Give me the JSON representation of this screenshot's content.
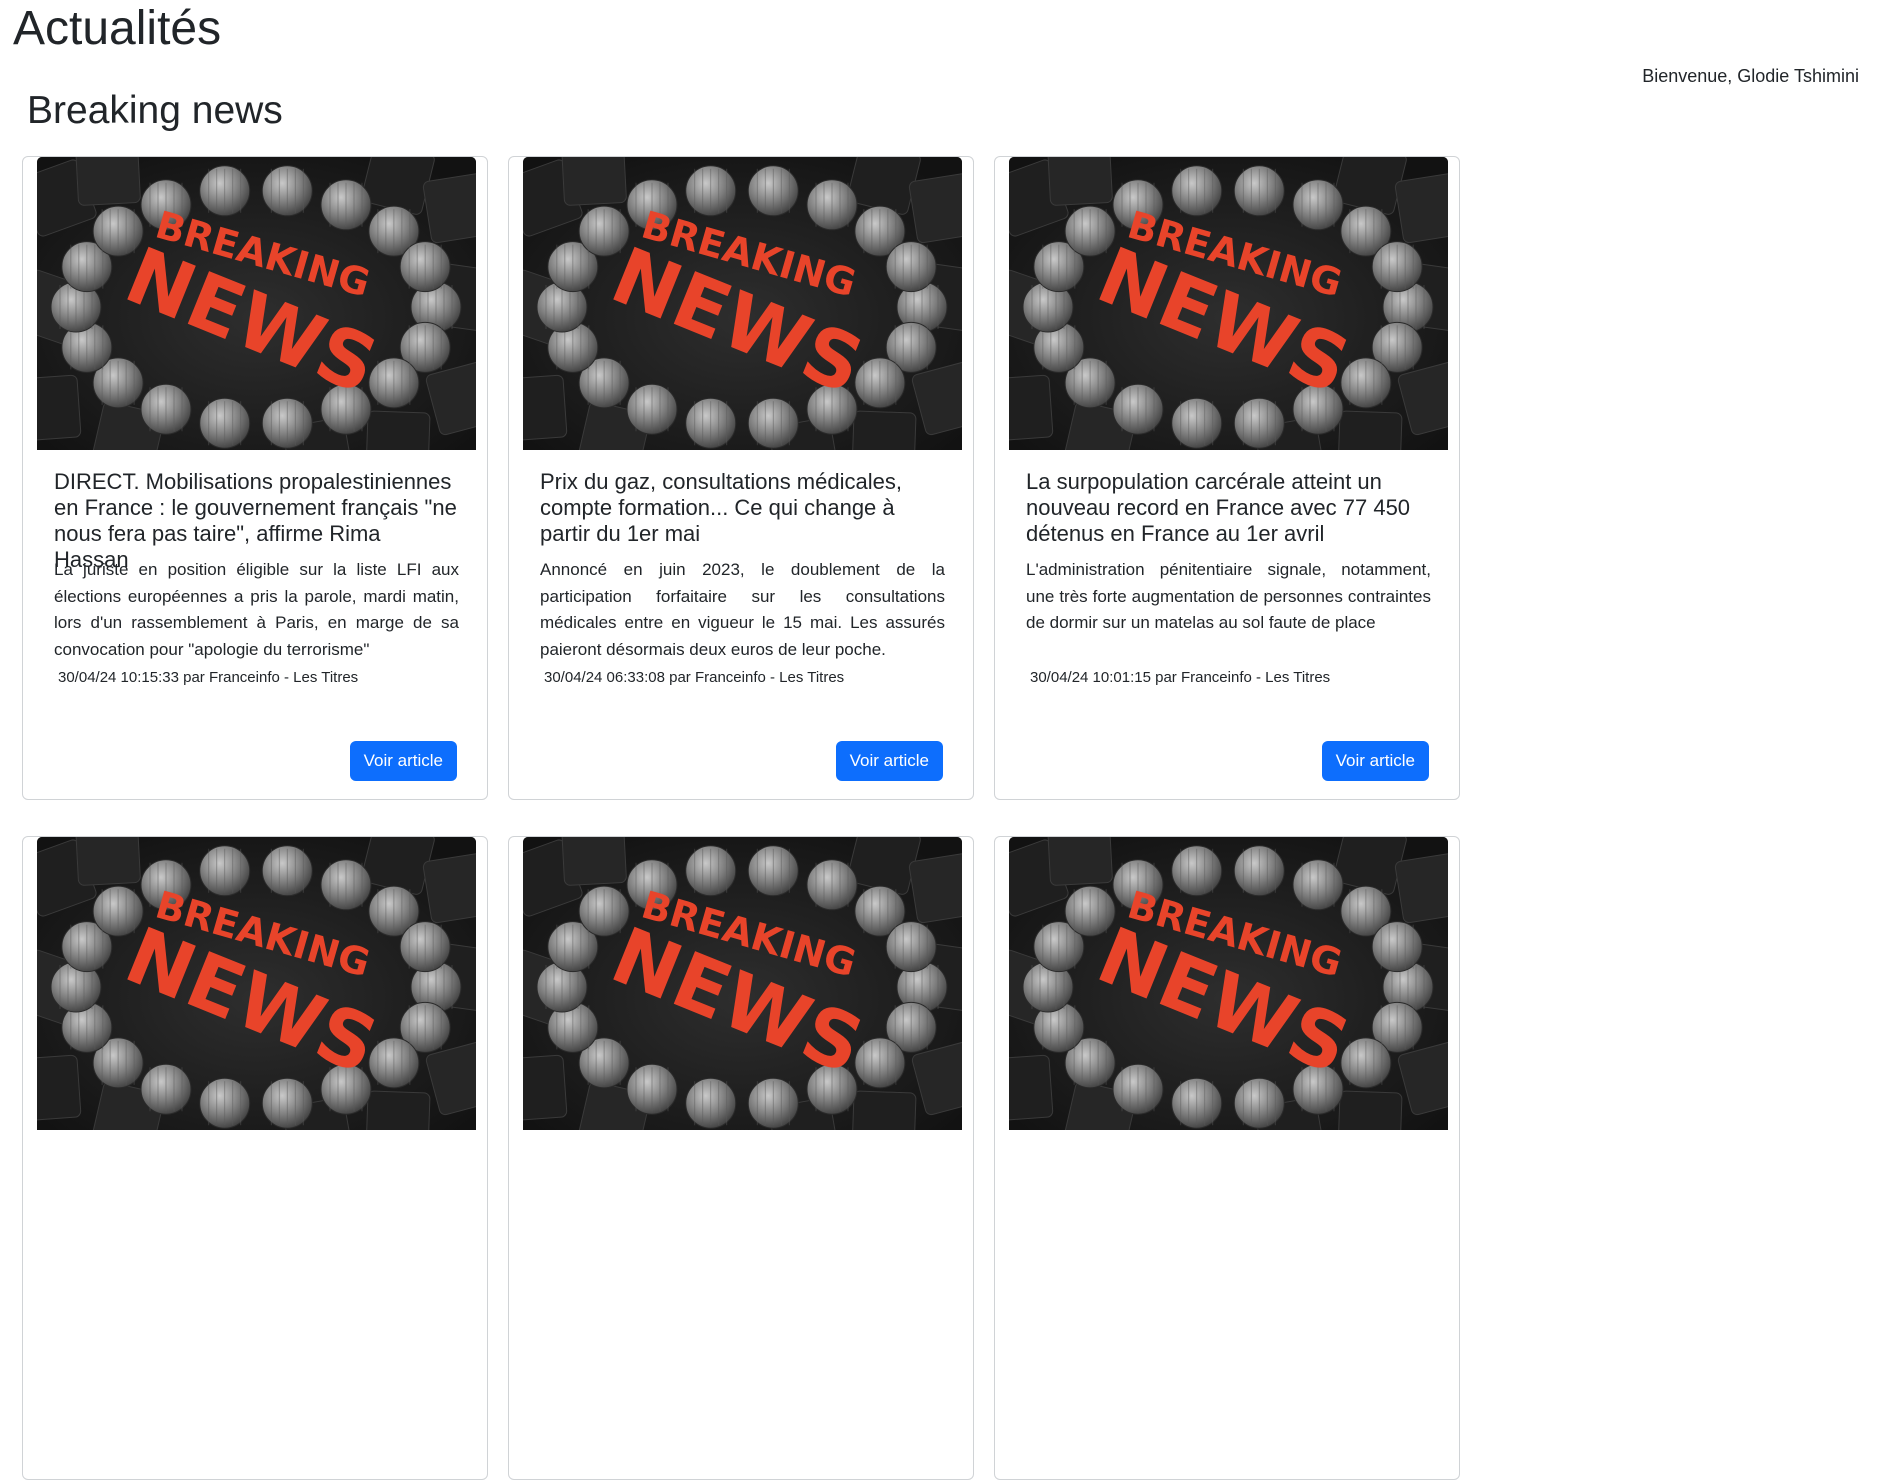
{
  "header": {
    "title": "Actualités",
    "welcome": "Bienvenue, Glodie Tshimini"
  },
  "section": {
    "title": "Breaking news"
  },
  "image": {
    "banner_top": "BREAKING",
    "banner_bottom": "NEWS",
    "accent": "#e8442a"
  },
  "articles": [
    {
      "title": "DIRECT. Mobilisations propalestiniennes en France : le gouvernement français \"ne nous fera pas taire\", affirme Rima Hassan",
      "text": "La juriste en position éligible sur la liste LFI aux élections européennes a pris la parole, mardi matin, lors d'un rassemblement à Paris, en marge de sa convocation pour \"apologie du terrorisme\"",
      "meta": "30/04/24 10:15:33 par Franceinfo - Les Titres",
      "button": "Voir article"
    },
    {
      "title": "Prix du gaz, consultations médicales, compte formation... Ce qui change à partir du 1er mai",
      "text": "Annoncé en juin 2023, le doublement de la participation forfaitaire sur les consultations médicales entre en vigueur le 15 mai. Les assurés paieront désormais deux euros de leur poche.",
      "meta": "30/04/24 06:33:08 par Franceinfo - Les Titres",
      "button": "Voir article"
    },
    {
      "title": "La surpopulation carcérale atteint un nouveau record en France avec 77 450 détenus en France au 1er avril",
      "text": "L'administration pénitentiaire signale, notamment, une très forte augmentation de personnes contraintes de dormir sur un matelas au sol faute de place",
      "meta": "30/04/24 10:01:15 par Franceinfo - Les Titres",
      "button": "Voir article"
    },
    {
      "title": "",
      "text": "",
      "meta": "",
      "button": ""
    },
    {
      "title": "",
      "text": "",
      "meta": "",
      "button": ""
    },
    {
      "title": "",
      "text": "",
      "meta": "",
      "button": ""
    }
  ]
}
